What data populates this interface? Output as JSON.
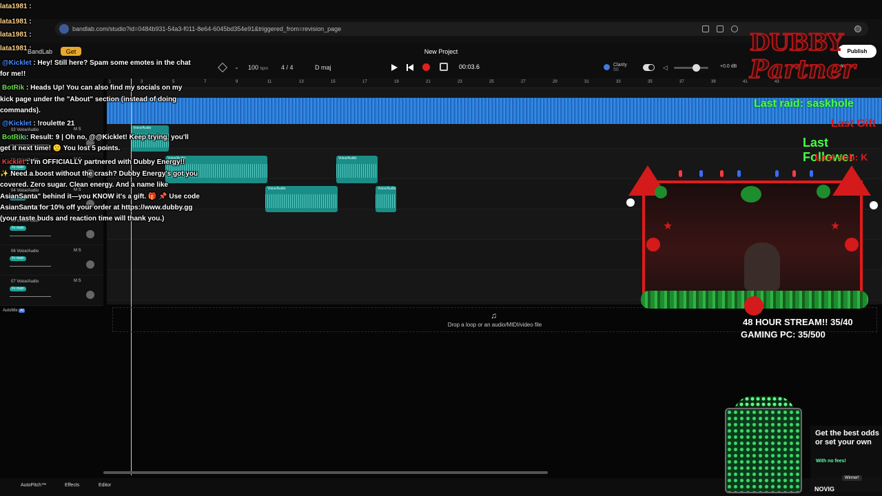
{
  "browser": {
    "url": "bandlab.com/studio?id=0484b931-54a3-f011-8e64-6045bd354e91&triggered_from=revision_page"
  },
  "app": {
    "project_title": "New Project",
    "publish_label": "Publish",
    "invite_label": "Invite",
    "get_label": "Get",
    "brand": "BandLab"
  },
  "transport": {
    "bpm": "100",
    "bpm_unit": "bpm",
    "time_signature": "4 / 4",
    "key": "D maj",
    "time": "00:03.6",
    "clarity_label": "Clarity",
    "clarity_value": "50",
    "volume_db": "+0.0 dB"
  },
  "ruler": {
    "ticks": [
      "1",
      "3",
      "5",
      "7",
      "9",
      "11",
      "13",
      "15",
      "17",
      "19",
      "21",
      "23",
      "25",
      "27",
      "29",
      "31",
      "33",
      "35",
      "37",
      "39",
      "41",
      "43"
    ]
  },
  "tracks": [
    {
      "num": "02",
      "name": "Voice/Audio",
      "fx": "Fx main"
    },
    {
      "num": "03",
      "name": "Voice/Audio",
      "fx": "Fx main"
    },
    {
      "num": "04",
      "name": "Voice/Audio",
      "fx": "Fx main"
    },
    {
      "num": "05",
      "name": "Voice/Audio",
      "fx": "Fx main"
    },
    {
      "num": "06",
      "name": "Voice/Audio",
      "fx": "Fx main"
    },
    {
      "num": "07",
      "name": "Voice/Audio",
      "fx": "Fx main"
    }
  ],
  "track_buttons": {
    "m": "M",
    "s": "S"
  },
  "clip_label": "Voice/Audio",
  "automix_label": "AutoMix",
  "automix_badge": "AI",
  "dropzone_text": "Drop a loop or an audio/MIDI/video file",
  "bottom": {
    "autopitch": "AutoPitch™",
    "effects": "Effects",
    "editor": "Editor"
  },
  "chat": [
    {
      "user": "lata1981",
      "sep": " :",
      "text": ""
    },
    {
      "user": "lata1981",
      "sep": " :",
      "text": ""
    },
    {
      "user": "lata1981",
      "sep": " :",
      "text": ""
    },
    {
      "user": "lata1981",
      "sep": " :",
      "text": ""
    },
    {
      "user": "@Kicklet",
      "sep": " : ",
      "text": "Hey! Still here? Spam some emotes in the chat"
    },
    {
      "user": "",
      "sep": "",
      "text": "for me!!"
    },
    {
      "user": "BotRik",
      "sep": " : ",
      "text": "Heads Up! You can also find my socials on my"
    },
    {
      "user": "",
      "sep": "",
      "text": "kick page under the \"About\" section (instead of doing"
    },
    {
      "user": "",
      "sep": "",
      "text": "commands)."
    },
    {
      "user": "@Kicklet",
      "sep": " : ",
      "text": "!roulette 21"
    },
    {
      "user": "BotRik",
      "sep": " : ",
      "text": "Result: 9 | Oh no, @@Kicklet! Keep trying, you'll"
    },
    {
      "user": "",
      "sep": "",
      "text": "get it next time! 🙁 You lost 5 points."
    },
    {
      "user": "Kicklet",
      "sep": " : ",
      "text": "I'm OFFICIALLY partnered with Dubby Energy!!"
    },
    {
      "user": "",
      "sep": "",
      "text": "✨ Need a boost without the crash? Dubby Energy's got you"
    },
    {
      "user": "",
      "sep": "",
      "text": "covered. Zero sugar. Clean energy. And a name like"
    },
    {
      "user": "",
      "sep": "",
      "text": "AsianSanta\" behind it—you KNOW it's a gift. 🎁 📌 Use code"
    },
    {
      "user": "",
      "sep": "",
      "text": "AsianSanta for 10% off your order at https://www.dubby.gg"
    },
    {
      "user": "",
      "sep": "",
      "text": "(your taste buds and reaction time will thank you.)"
    }
  ],
  "overlay": {
    "dubby_line1": "DUBBY",
    "dubby_line2": "Partner",
    "last_raid": "Last raid: saskhole",
    "last_gift": "Last Gift",
    "last_follow": "Last Follower",
    "last_sub": "Last sub: K",
    "stream_goal": "48 HOUR STREAM!! 35/40",
    "gaming_pc": "GAMING PC: 35/500",
    "novig_text": "Get the best odds or set your own",
    "novig_fees": "With no fees!",
    "novig_winner": "Winner!",
    "novig_logo": "NOVIG"
  },
  "colors": {
    "accent_blue": "#3f95ea",
    "clip_teal": "#1b8d87",
    "record_red": "#e02020",
    "overlay_green": "#48ff48",
    "overlay_red": "#e01818"
  }
}
